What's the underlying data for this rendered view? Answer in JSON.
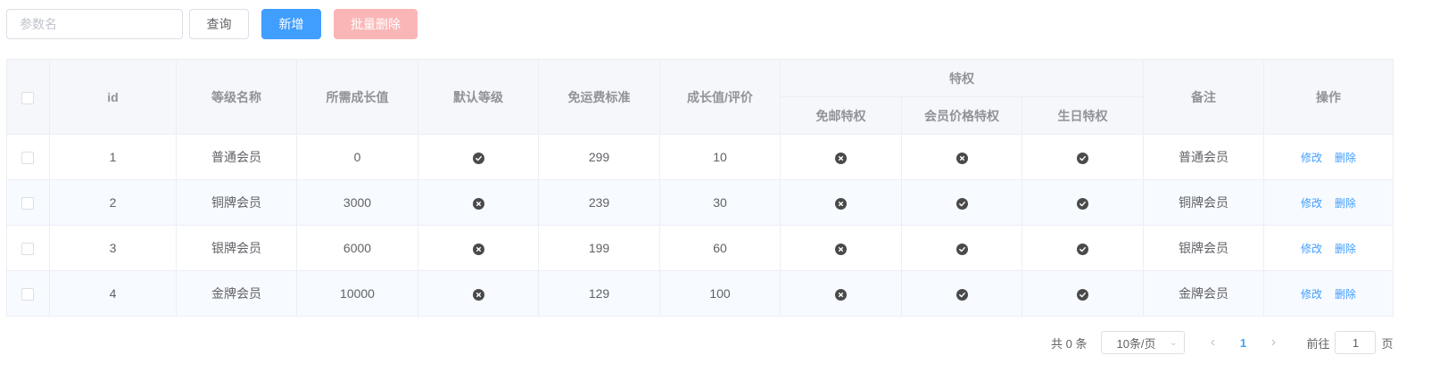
{
  "toolbar": {
    "search_placeholder": "参数名",
    "query_label": "查询",
    "add_label": "新增",
    "batch_delete_label": "批量删除"
  },
  "table": {
    "headers": {
      "id": "id",
      "name": "等级名称",
      "growth": "所需成长值",
      "default_level": "默认等级",
      "free_shipping_std": "免运费标准",
      "growth_per_review": "成长值/评价",
      "privileges": "特权",
      "privilege_shipping": "免邮特权",
      "privilege_price": "会员价格特权",
      "privilege_birthday": "生日特权",
      "note": "备注",
      "ops": "操作"
    },
    "rows": [
      {
        "id": "1",
        "name": "普通会员",
        "growth": "0",
        "default": "check",
        "free_shipping": "299",
        "per_review": "10",
        "shipping": "cross",
        "price": "cross",
        "birthday": "check",
        "note": "普通会员",
        "edit": "修改",
        "delete": "删除"
      },
      {
        "id": "2",
        "name": "铜牌会员",
        "growth": "3000",
        "default": "cross",
        "free_shipping": "239",
        "per_review": "30",
        "shipping": "cross",
        "price": "check",
        "birthday": "check",
        "note": "铜牌会员",
        "edit": "修改",
        "delete": "删除"
      },
      {
        "id": "3",
        "name": "银牌会员",
        "growth": "6000",
        "default": "cross",
        "free_shipping": "199",
        "per_review": "60",
        "shipping": "cross",
        "price": "check",
        "birthday": "check",
        "note": "银牌会员",
        "edit": "修改",
        "delete": "删除"
      },
      {
        "id": "4",
        "name": "金牌会员",
        "growth": "10000",
        "default": "cross",
        "free_shipping": "129",
        "per_review": "100",
        "shipping": "cross",
        "price": "check",
        "birthday": "check",
        "note": "金牌会员",
        "edit": "修改",
        "delete": "删除"
      }
    ]
  },
  "pagination": {
    "total_label": "共 0 条",
    "page_size": "10条/页",
    "current_page": "1",
    "goto_label": "前往",
    "goto_value": "1",
    "page_suffix": "页"
  },
  "colors": {
    "primary": "#409eff",
    "danger_disabled": "#fab6b6",
    "icon": "#4a4a4a"
  }
}
